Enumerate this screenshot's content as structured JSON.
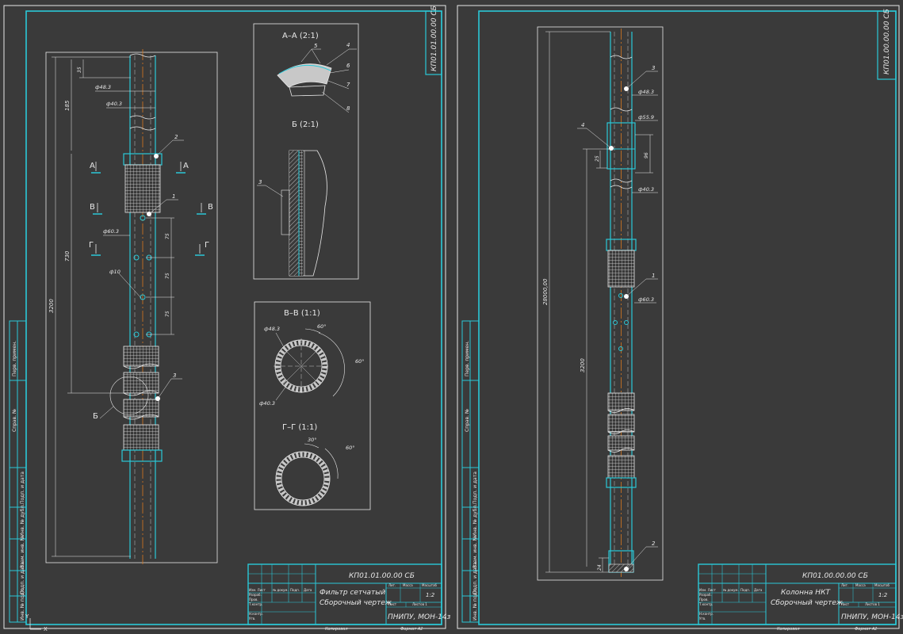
{
  "sheet1": {
    "code_vertical": "КП01.01.00.00 СБ",
    "title_code": "КП01.01.00.00 СБ",
    "title_line1": "Фильтр сетчатый",
    "title_line2": "Сборочный чертеж",
    "org": "ПНИПУ, МОН-14з",
    "scale": "1:2",
    "format": "Формат  А2",
    "copied": "Копировал",
    "dims": {
      "total": "3200",
      "d_upper": "185",
      "d_35": "35",
      "d_730": "730",
      "d483": "ф48.3",
      "d403": "ф40.3",
      "d603": "ф60.3",
      "d10": "ф10",
      "d75a": "75",
      "d75b": "75",
      "d75c": "75"
    },
    "leaders": {
      "p1": "1",
      "p2": "2",
      "p3": "3"
    },
    "sections": {
      "A": "А",
      "B": "В",
      "G": "Г",
      "Bview": "Б"
    },
    "detail_AA": "А–А (2:1)",
    "detail_B": "Б (2:1)",
    "detail_VV": "В–В (1:1)",
    "detail_GG": "Г–Г (1:1)",
    "aa_items": [
      "5",
      "4",
      "6",
      "7",
      "8"
    ],
    "b_item": "3",
    "vv_d483": "ф48.3",
    "vv_d403": "ф40.3",
    "vv_a1": "60°",
    "vv_a2": "60°",
    "gg_a1": "30°",
    "gg_a2": "60°"
  },
  "sheet2": {
    "code_vertical": "КП01.00.00.00 СБ",
    "title_code": "КП01.00.00.00 СБ",
    "title_line1": "Колонна НКТ",
    "title_line2": "Сборочный чертеж",
    "org": "ПНИПУ, МОН-14з",
    "scale": "1:2",
    "format": "Формат  А2",
    "copied": "Копировал",
    "dims": {
      "total": "28000,00",
      "d3200": "3200",
      "d483": "ф48.3",
      "d559": "ф55.9",
      "d403": "ф40.3",
      "d603": "ф60.3",
      "d96": "96",
      "d25": "25",
      "d24": "24"
    },
    "leaders": {
      "p1": "1",
      "p2": "2",
      "p3": "3",
      "p4": "4"
    }
  },
  "title_block_headers": {
    "izm": "Изм. Лист",
    "ndok": "№ докум.",
    "podp": "Подп.",
    "data": "Дата",
    "razrab": "Разраб.",
    "prov": "Пров.",
    "tkontr": "Т.контр.",
    "nkontr": "Н.контр.",
    "utv": "Утв.",
    "lit": "Лит.",
    "massa": "Масса",
    "masshtab": "Масштаб",
    "list": "Лист",
    "listov": "Листов 1"
  },
  "side_strip": [
    "Перв. примен.",
    "Справ. №",
    "Подп. и дата",
    "Инв. № дубл.",
    "Взам. инв. №",
    "Подп. и дата",
    "Инв. № подл."
  ],
  "colors": {
    "background": "#3a3a3a",
    "frame": "#2ac8d8",
    "ink": "#e8e8e8",
    "axis": "#d87820"
  }
}
